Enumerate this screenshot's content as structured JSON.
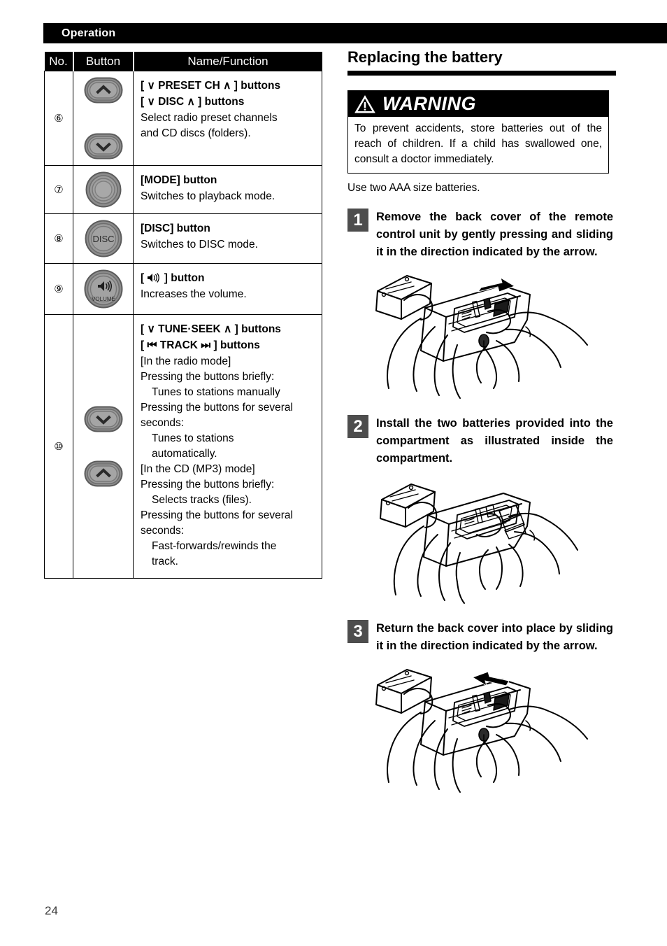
{
  "header": {
    "running_title": "Operation"
  },
  "table": {
    "columns": [
      "No.",
      "Button",
      "Name/Function"
    ],
    "rows": [
      {
        "no": "⑥",
        "button_icons": [
          "up-chevron-oval-button",
          "down-chevron-oval-button"
        ],
        "lines": [
          {
            "style": "bold",
            "text": "[ ∨  PRESET CH  ∧ ] buttons"
          },
          {
            "style": "bold",
            "text": "[ ∨  DISC  ∧ ] buttons"
          },
          {
            "style": "plain",
            "text": "Select radio preset channels"
          },
          {
            "style": "plain",
            "text": "and CD discs (folders)."
          }
        ]
      },
      {
        "no": "⑦",
        "button_icons": [
          "mode-round-button"
        ],
        "lines": [
          {
            "style": "bold",
            "text": "[MODE] button"
          },
          {
            "style": "plain",
            "text": "Switches to playback mode."
          }
        ]
      },
      {
        "no": "⑧",
        "button_icons": [
          "disc-round-button"
        ],
        "lines": [
          {
            "style": "bold",
            "text": "[DISC] button"
          },
          {
            "style": "plain",
            "text": "Switches to DISC mode."
          }
        ]
      },
      {
        "no": "⑨",
        "button_icons": [
          "volume-round-button"
        ],
        "lines": [
          {
            "style": "bold",
            "text": "[ 🔊 ] button"
          },
          {
            "style": "plain",
            "text": "Increases the volume."
          }
        ]
      },
      {
        "no": "⑩",
        "button_icons": [
          "down-chevron-oval-button",
          "up-chevron-oval-button"
        ],
        "lines": [
          {
            "style": "bold",
            "text": "[ ∨  TUNE·SEEK  ∧ ] buttons"
          },
          {
            "style": "bold",
            "text": "[ ⏮  TRACK  ⏭ ] buttons"
          },
          {
            "style": "plain",
            "text": "[In the radio mode]"
          },
          {
            "style": "plain",
            "text": "Pressing the buttons briefly:"
          },
          {
            "style": "plain-indent",
            "text": "Tunes to stations manually"
          },
          {
            "style": "plain",
            "text": "Pressing the buttons for several seconds:"
          },
          {
            "style": "plain-indent",
            "text": "Tunes to stations"
          },
          {
            "style": "plain-indent",
            "text": "automatically."
          },
          {
            "style": "plain",
            "text": "[In the CD (MP3) mode]"
          },
          {
            "style": "plain",
            "text": "Pressing the buttons briefly:"
          },
          {
            "style": "plain-indent",
            "text": "Selects tracks (files)."
          },
          {
            "style": "plain",
            "text": "Pressing the buttons for several seconds:"
          },
          {
            "style": "plain-indent",
            "text": "Fast-forwards/rewinds the"
          },
          {
            "style": "plain-indent",
            "text": "track."
          }
        ]
      }
    ],
    "button_labels": {
      "disc": "DISC",
      "volume": "VOLUME"
    }
  },
  "battery": {
    "title": "Replacing the battery",
    "warning": {
      "label": "WARNING",
      "icon": "warning-triangle-icon",
      "body": "To prevent accidents, store batteries out of the reach of children. If a child has swallowed one, consult a doctor immediately."
    },
    "note": "Use two AAA size batteries.",
    "steps": [
      {
        "number": "1",
        "text": "Remove the back cover of the remote control unit by gently pressing and sliding it in the direction indicated by the arrow.",
        "figure": "hands-holding-remote-cover-sliding-off-right-arrow"
      },
      {
        "number": "2",
        "text": "Install the two batteries provided into the compartment as illustrated inside the compartment.",
        "figure": "hands-inserting-batteries-into-remote-compartment"
      },
      {
        "number": "3",
        "text": "Return the back cover into place by sliding it in the direction indicated by the arrow.",
        "figure": "hands-holding-remote-cover-sliding-on-left-arrow"
      }
    ]
  },
  "footer": {
    "page_number": "24"
  },
  "colors": {
    "header_bar": "#000000",
    "step_badge": "#4d4d4d",
    "button_face": "#8c8c8c",
    "rule": "#000000"
  }
}
